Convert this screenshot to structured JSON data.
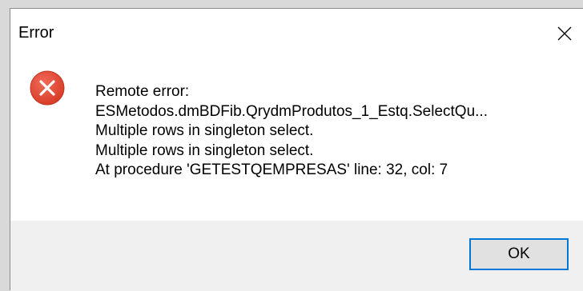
{
  "dialog": {
    "title": "Error",
    "icon": "error-circle-x-icon",
    "message_lines": [
      "Remote error:",
      "ESMetodos.dmBDFib.QrydmProdutos_1_Estq.SelectQu...",
      "Multiple rows in singleton select.",
      "Multiple rows in singleton select.",
      "At procedure 'GETESTQEMPRESAS' line: 32, col: 7"
    ],
    "ok_label": "OK"
  },
  "colors": {
    "error_red": "#e81123",
    "focus_blue": "#0078d7",
    "footer_bg": "#f0f0f0"
  }
}
